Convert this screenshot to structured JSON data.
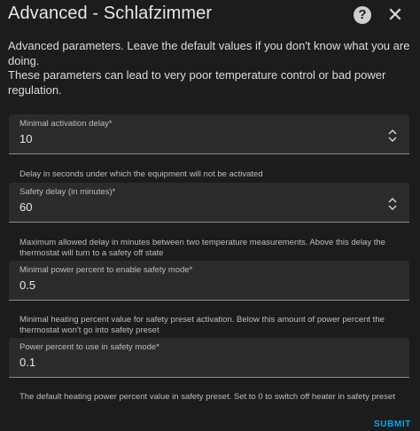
{
  "dialog": {
    "title": "Advanced - Schlafzimmer",
    "help_label": "?",
    "close_label": "✕",
    "intro_line1": "Advanced parameters. Leave the default values if you don't know what you are doing.",
    "intro_line2": "These parameters can lead to very poor temperature control or bad power regulation.",
    "submit_label": "SUBMIT"
  },
  "fields": [
    {
      "label": "Minimal activation delay*",
      "value": "10",
      "helper": "Delay in seconds under which the equipment will not be activated"
    },
    {
      "label": "Safety delay (in minutes)*",
      "value": "60",
      "helper": "Maximum allowed delay in minutes between two temperature measurements. Above this delay the thermostat will turn to a safety off state"
    },
    {
      "label": "Minimal power percent to enable safety mode*",
      "value": "0.5",
      "helper": "Minimal heating percent value for safety preset activation. Below this amount of power percent the thermostat won't go into safety preset"
    },
    {
      "label": "Power percent to use in safety mode*",
      "value": "0.1",
      "helper": "The default heating power percent value in safety preset. Set to 0 to switch off heater in safety preset"
    }
  ]
}
